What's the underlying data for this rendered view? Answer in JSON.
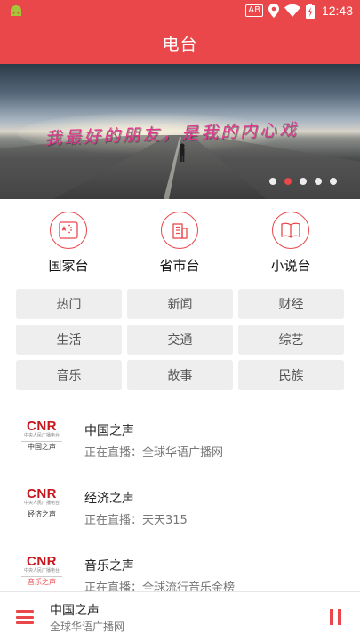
{
  "statusbar": {
    "time": "12:43",
    "ab_badge": "AB",
    "icons": [
      "android-icon",
      "location-icon",
      "wifi-icon",
      "battery-charging-icon"
    ]
  },
  "appbar": {
    "title": "电台"
  },
  "banner": {
    "caption": "我最好的朋友，是我的内心戏",
    "dots_count": 5,
    "active_dot": 2
  },
  "categories": [
    {
      "label": "国家台",
      "icon": "national-radio-icon"
    },
    {
      "label": "省市台",
      "icon": "building-icon"
    },
    {
      "label": "小说台",
      "icon": "book-icon"
    }
  ],
  "tags": [
    "热门",
    "新闻",
    "财经",
    "生活",
    "交通",
    "综艺",
    "音乐",
    "故事",
    "民族"
  ],
  "stations": [
    {
      "name": "中国之声",
      "now": "正在直播：全球华语广播网",
      "logo_main": "CNR",
      "logo_mini": "中央人民广播电台",
      "logo_sub": "中国之声"
    },
    {
      "name": "经济之声",
      "now": "正在直播：天天315",
      "logo_main": "CNR",
      "logo_mini": "中央人民广播电台",
      "logo_sub": "经济之声"
    },
    {
      "name": "音乐之声",
      "now": "正在直播：全球流行音乐金榜",
      "logo_main": "CNR",
      "logo_mini": "中央人民广播电台",
      "logo_sub": "音乐之声"
    }
  ],
  "player": {
    "title": "中国之声",
    "subtitle": "全球华语广播网"
  },
  "colors": {
    "accent": "#e9474a",
    "tag_bg": "#eeeeee",
    "logo_red": "#c8161d"
  }
}
